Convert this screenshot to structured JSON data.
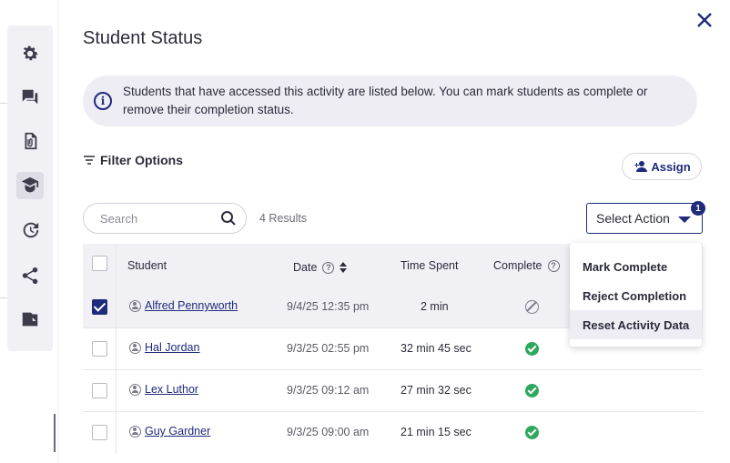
{
  "rail": {
    "icons": [
      "gear-icon",
      "chat-icon",
      "attachment-icon",
      "student-icon",
      "history-icon",
      "share-icon",
      "folder-icon"
    ]
  },
  "panel": {
    "title": "Student Status",
    "info_text": "Students that have accessed this activity are listed below. You can mark students as complete or remove their completion status.",
    "filter_label": "Filter Options",
    "assign_label": "Assign",
    "search_placeholder": "Search",
    "results_text": "4 Results",
    "select_action_label": "Select Action",
    "badge_count": "1"
  },
  "table": {
    "headers": {
      "student": "Student",
      "date": "Date",
      "time_spent": "Time Spent",
      "complete": "Complete"
    },
    "rows": [
      {
        "name": "Alfred Pennyworth",
        "date": "9/4/25 12:35 pm",
        "time": "2 min",
        "status": "not-complete",
        "selected": true
      },
      {
        "name": "Hal Jordan",
        "date": "9/3/25 02:55 pm",
        "time": "32 min 45 sec",
        "status": "complete",
        "selected": false
      },
      {
        "name": "Lex Luthor",
        "date": "9/3/25 09:12 am",
        "time": "27 min 32 sec",
        "status": "complete",
        "selected": false
      },
      {
        "name": "Guy Gardner",
        "date": "9/3/25 09:00 am",
        "time": "21 min 15 sec",
        "status": "complete",
        "selected": false
      }
    ]
  },
  "dropdown": {
    "items": [
      "Mark Complete",
      "Reject Completion",
      "Reset Activity Data"
    ]
  },
  "colors": {
    "accent": "#1f2b7b",
    "success": "#2ea85c",
    "surface": "#f1f0f5"
  }
}
